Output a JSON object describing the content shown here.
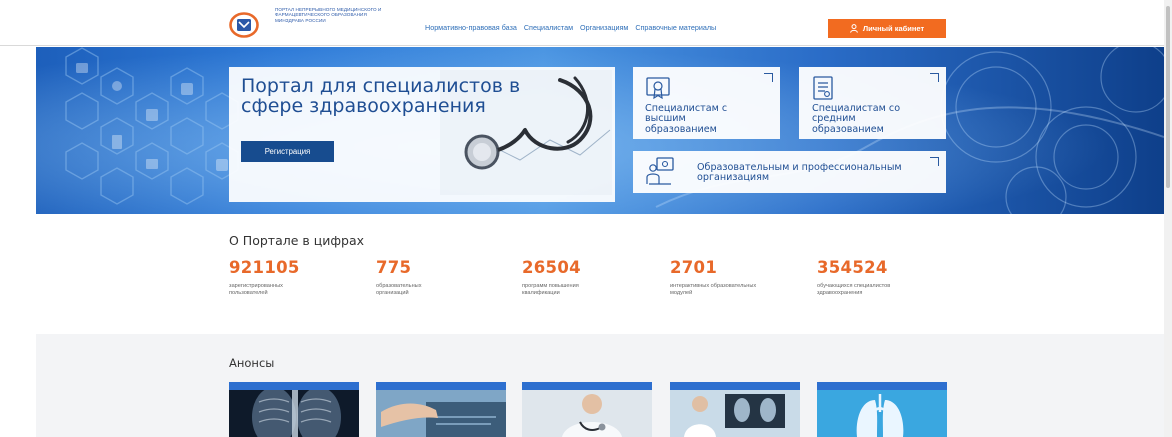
{
  "header": {
    "logo_text": "ПОРТАЛ НЕПРЕРЫВНОГО МЕДИЦИНСКОГО И ФАРМАЦЕВТИЧЕСКОГО ОБРАЗОВАНИЯ МИНЗДРАВА РОССИИ",
    "nav": [
      "Нормативно-правовая база",
      "Специалистам",
      "Организациям",
      "Справочные материалы"
    ],
    "cabinet_label": "Личный кабинет"
  },
  "hero": {
    "title": "Портал для специалистов в сфере здравоохранения",
    "register_label": "Регистрация",
    "tiles": {
      "higher": "Специалистам с высшим образованием",
      "secondary": "Специалистам со средним образованием",
      "orgs": "Образовательным и профессиональным организациям"
    }
  },
  "stats": {
    "title": "О Портале в цифрах",
    "items": [
      {
        "value": "921105",
        "label": "зарегистрированных пользователей"
      },
      {
        "value": "775",
        "label": "образовательных организаций"
      },
      {
        "value": "26504",
        "label": "программ повышения квалификации"
      },
      {
        "value": "2701",
        "label": "интерактивных образовательных модулей"
      },
      {
        "value": "354524",
        "label": "обучающихся специалистов здравоохранения"
      }
    ]
  },
  "announcements": {
    "title": "Анонсы"
  },
  "colors": {
    "accent": "#f26b20",
    "primary": "#1f4e93",
    "stat_number": "#e8692a"
  }
}
